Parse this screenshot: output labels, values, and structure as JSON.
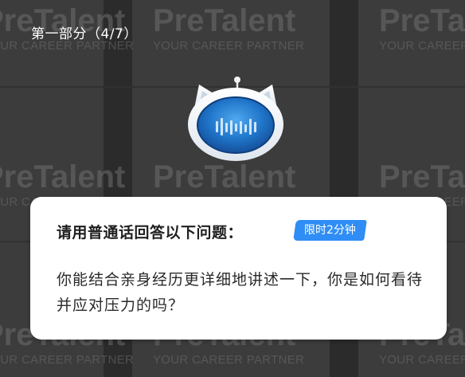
{
  "header": {
    "progress": "第一部分（4/7）"
  },
  "watermark": {
    "brand": "PreTalent",
    "tagline": "YOUR CAREER PARTNER"
  },
  "avatar": {
    "icon": "robot-cat-icon"
  },
  "question_card": {
    "heading": "请用普通话回答以下问题：",
    "time_limit": "限时2分钟",
    "question": "你能结合亲身经历更详细地讲述一下，你是如何看待并应对压力的吗？"
  },
  "colors": {
    "badge": "#2f8df5",
    "background": "#3a3a3a",
    "card": "#ffffff"
  }
}
